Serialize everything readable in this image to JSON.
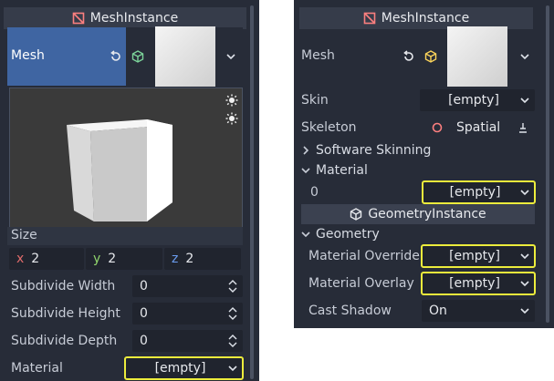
{
  "left": {
    "header": "MeshInstance",
    "mesh_label": "Mesh",
    "size_label": "Size",
    "size": {
      "x_label": "x",
      "x": "2",
      "y_label": "y",
      "y": "2",
      "z_label": "z",
      "z": "2"
    },
    "props": [
      {
        "label": "Subdivide Width",
        "value": "0"
      },
      {
        "label": "Subdivide Height",
        "value": "0"
      },
      {
        "label": "Subdivide Depth",
        "value": "0"
      }
    ],
    "material_label": "Material",
    "material_value": "[empty]"
  },
  "right": {
    "header": "MeshInstance",
    "mesh_label": "Mesh",
    "skin_label": "Skin",
    "skin_value": "[empty]",
    "skeleton_label": "Skeleton",
    "skeleton_value": "Spatial",
    "software_skinning": "Software Skinning",
    "material_section": "Material",
    "material_index": "0",
    "material_index_value": "[empty]",
    "geometry_instance_header": "GeometryInstance",
    "geometry_section": "Geometry",
    "material_override_label": "Material Override",
    "material_override_value": "[empty]",
    "material_overlay_label": "Material Overlay",
    "material_overlay_value": "[empty]",
    "cast_shadow_label": "Cast Shadow",
    "cast_shadow_value": "On"
  },
  "colors": {
    "highlight": "#ecec3c",
    "accent": "#3f65a2",
    "node_red": "#fc7f7f",
    "mesh_icon": "#fdd55a"
  }
}
